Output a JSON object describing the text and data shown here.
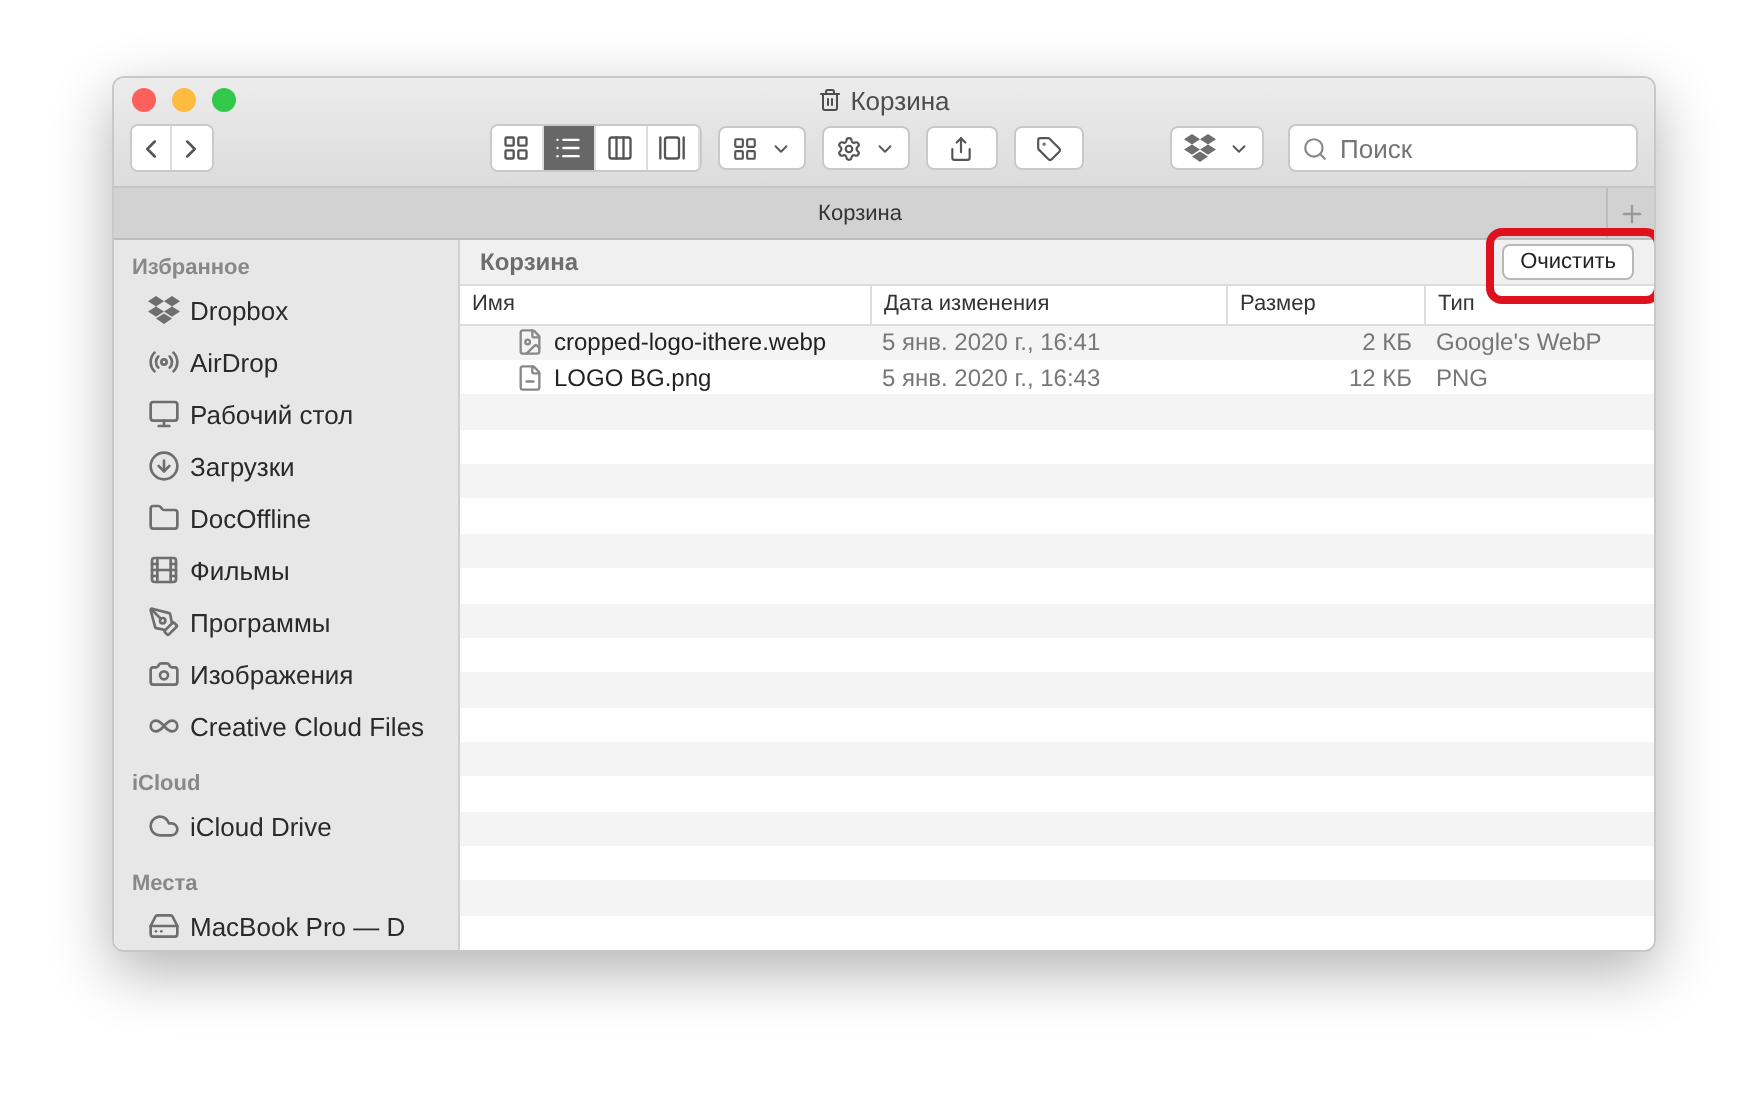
{
  "window": {
    "title": "Корзина"
  },
  "toolbar": {
    "views": [
      {
        "kind": "icons",
        "selected": false
      },
      {
        "kind": "list",
        "selected": true
      },
      {
        "kind": "columns",
        "selected": false
      },
      {
        "kind": "gallery",
        "selected": false
      }
    ],
    "search": {
      "placeholder": "Поиск"
    }
  },
  "tab_bar": {
    "title": "Корзина"
  },
  "sidebar": {
    "sections": [
      {
        "title": "Избранное",
        "items": [
          {
            "kind": "dropbox",
            "label": "Dropbox"
          },
          {
            "kind": "airdrop",
            "label": "AirDrop"
          },
          {
            "kind": "desktop",
            "label": "Рабочий стол"
          },
          {
            "kind": "downloads",
            "label": "Загрузки"
          },
          {
            "kind": "folder",
            "label": "DocOffline"
          },
          {
            "kind": "movies",
            "label": "Фильмы"
          },
          {
            "kind": "apps",
            "label": "Программы"
          },
          {
            "kind": "pictures",
            "label": "Изображения"
          },
          {
            "kind": "cc",
            "label": "Creative Cloud Files"
          }
        ]
      },
      {
        "title": "iCloud",
        "items": [
          {
            "kind": "cloud",
            "label": "iCloud Drive"
          }
        ]
      },
      {
        "title": "Места",
        "items": [
          {
            "kind": "disk",
            "label": "MacBook Pro — D"
          }
        ]
      }
    ]
  },
  "path_bar": {
    "title": "Корзина",
    "empty_button": "Очистить",
    "highlighted": true
  },
  "table": {
    "columns": [
      "Имя",
      "Дата изменения",
      "Размер",
      "Тип"
    ],
    "rows": [
      {
        "kind": "webp",
        "name": "cropped-logo-ithere.webp",
        "date": "5 янв. 2020 г., 16:41",
        "size": "2 КБ",
        "type": "Google's WebP"
      },
      {
        "kind": "png",
        "name": "LOGO BG.png",
        "date": "5 янв. 2020 г., 16:43",
        "size": "12 КБ",
        "type": "PNG"
      }
    ]
  }
}
